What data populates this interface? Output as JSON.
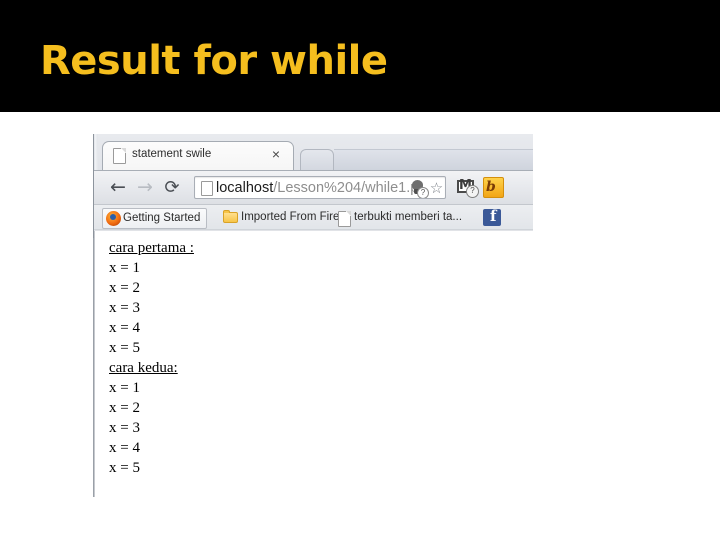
{
  "slide": {
    "title": "Result for  while",
    "title_color": "#F5BE1E",
    "band_color": "#000000",
    "background_color": "#FFFFFF"
  },
  "browser": {
    "tab": {
      "title": "statement swile",
      "favicon": "page-icon",
      "close_label": "×"
    },
    "new_tab_label": "",
    "toolbar": {
      "back_label": "←",
      "forward_label": "→",
      "reload_label": "⟳",
      "omnibox": {
        "host": "localhost",
        "path": "/Lesson%204/while1.p",
        "full_url": "localhost/Lesson%204/while1.p",
        "bulb_badge": "?",
        "star_label": "☆"
      },
      "extensions": [
        {
          "name": "gmail-extension-icon",
          "badge": "?"
        },
        {
          "name": "orange-extension-icon",
          "glyph": "b"
        }
      ]
    },
    "bookmarks": [
      {
        "label": "Getting Started",
        "icon": "firefox-icon"
      },
      {
        "label": "Imported From Firef..",
        "icon": "folder-icon"
      },
      {
        "label": "terbukti memberi ta...",
        "icon": "page-icon"
      },
      {
        "label": "",
        "icon": "facebook-icon"
      }
    ],
    "page": {
      "lines": [
        {
          "text": "cara pertama :",
          "heading": true
        },
        {
          "text": "x = 1",
          "heading": false
        },
        {
          "text": "x = 2",
          "heading": false
        },
        {
          "text": "x = 3",
          "heading": false
        },
        {
          "text": "x = 4",
          "heading": false
        },
        {
          "text": "x = 5",
          "heading": false
        },
        {
          "text": "cara kedua:",
          "heading": true
        },
        {
          "text": "x = 1",
          "heading": false
        },
        {
          "text": "x = 2",
          "heading": false
        },
        {
          "text": "x = 3",
          "heading": false
        },
        {
          "text": "x = 4",
          "heading": false
        },
        {
          "text": "x = 5",
          "heading": false
        }
      ]
    }
  }
}
